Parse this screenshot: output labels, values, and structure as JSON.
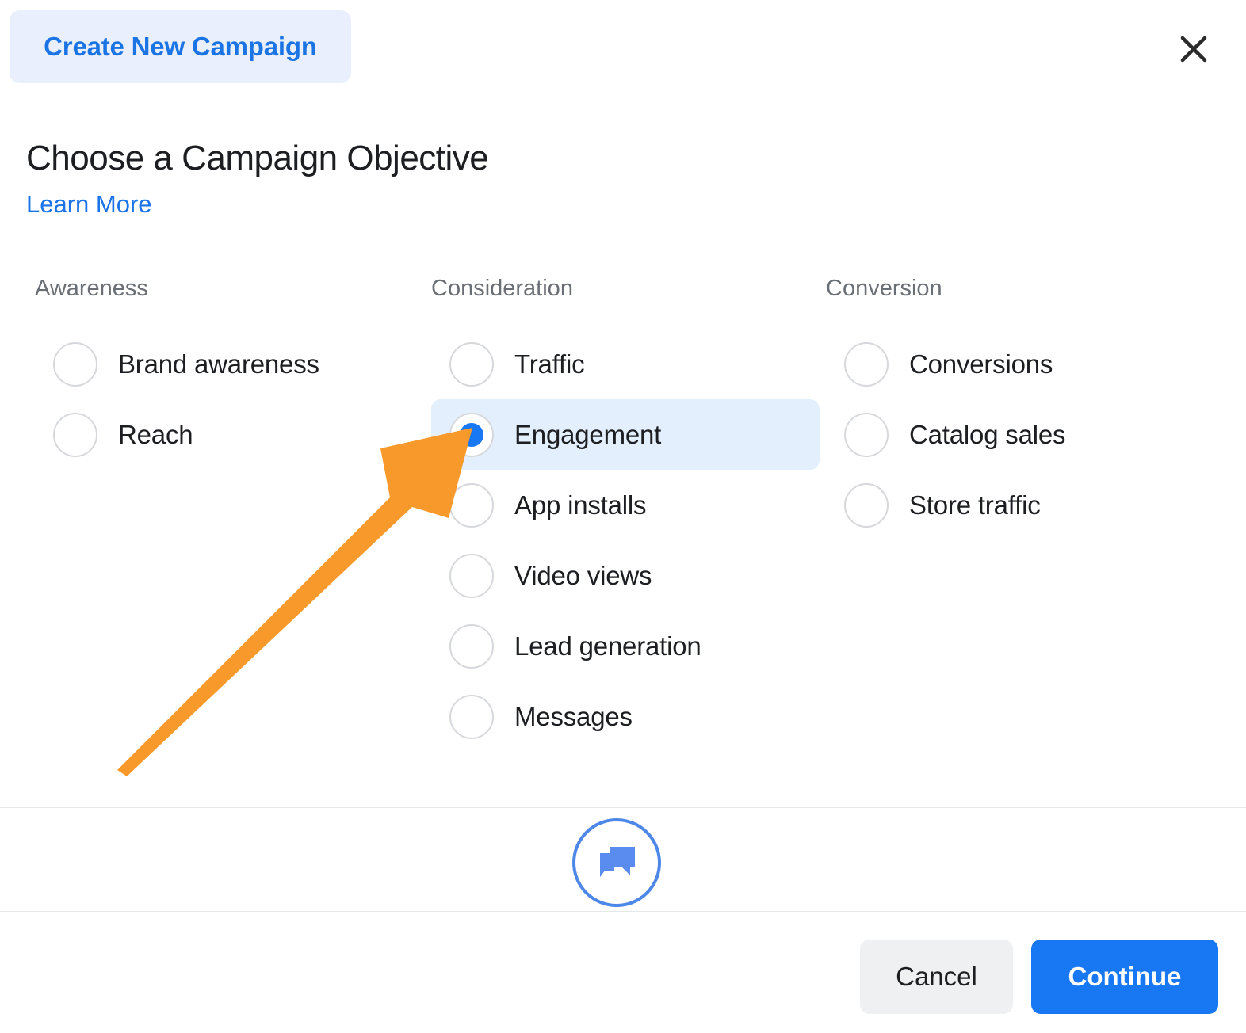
{
  "header": {
    "badge_label": "Create New Campaign",
    "close_icon": "close-icon"
  },
  "section": {
    "title": "Choose a Campaign Objective",
    "learn_more_label": "Learn More"
  },
  "colors": {
    "accent_blue": "#1877f2",
    "link_blue": "#1a73e8",
    "badge_bg": "#e9effd",
    "selected_row_bg": "#e3effc",
    "annotation_orange": "#f79a2b",
    "cancel_bg": "#eff0f2",
    "radio_border": "#d6d8db",
    "divider": "#e6e7e9"
  },
  "columns": [
    {
      "heading": "Awareness",
      "options": [
        {
          "label": "Brand awareness",
          "selected": false
        },
        {
          "label": "Reach",
          "selected": false
        }
      ]
    },
    {
      "heading": "Consideration",
      "options": [
        {
          "label": "Traffic",
          "selected": false
        },
        {
          "label": "Engagement",
          "selected": true
        },
        {
          "label": "App installs",
          "selected": false
        },
        {
          "label": "Video views",
          "selected": false
        },
        {
          "label": "Lead generation",
          "selected": false
        },
        {
          "label": "Messages",
          "selected": false
        }
      ]
    },
    {
      "heading": "Conversion",
      "options": [
        {
          "label": "Conversions",
          "selected": false
        },
        {
          "label": "Catalog sales",
          "selected": false
        },
        {
          "label": "Store traffic",
          "selected": false
        }
      ]
    }
  ],
  "annotation": {
    "type": "arrow",
    "points_to": "Engagement",
    "color": "#f79a2b"
  },
  "chat": {
    "icon": "chat-bubbles-icon"
  },
  "footer": {
    "cancel_label": "Cancel",
    "continue_label": "Continue"
  }
}
